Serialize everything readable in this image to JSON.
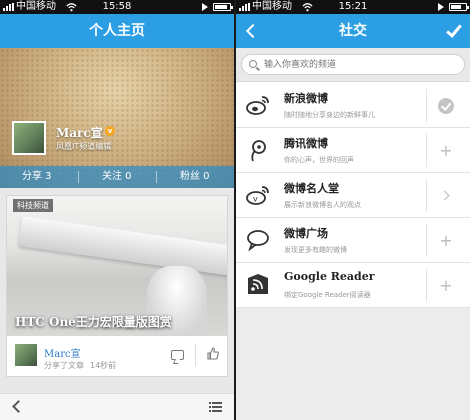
{
  "colors": {
    "nav_blue": "#2c9ee4",
    "stats_bar": "#2d8cc8",
    "link_blue": "#2c7bc4"
  },
  "left": {
    "status": {
      "carrier": "中国移动",
      "time": "15:58"
    },
    "nav": {
      "title": "个人主页"
    },
    "profile": {
      "name": "Marc宣",
      "verified_badge": "v",
      "bio": "凤凰IT频道编辑",
      "stats": {
        "shares": "分享 3",
        "following": "关注 0",
        "followers": "粉丝 0"
      }
    },
    "feed": {
      "tag": "科技频道",
      "title": "HTC One王力宏限量版图赏",
      "author": "Marc宣",
      "action": "分享了文章",
      "time": "14秒前",
      "icons": [
        "comment-icon",
        "like-icon"
      ]
    },
    "bottombar": {
      "icons": [
        "back-icon",
        "menu-icon"
      ]
    }
  },
  "right": {
    "status": {
      "carrier": "中国移动",
      "time": "15:21"
    },
    "nav": {
      "title": "社交",
      "icons": [
        "back-icon",
        "check-icon"
      ]
    },
    "search": {
      "placeholder": "输入你喜欢的频道"
    },
    "channels": [
      {
        "name": "新浪微博",
        "desc": "随时随地分享身边的新鲜事儿",
        "icon": "sina-weibo-icon",
        "action": "added-check-icon"
      },
      {
        "name": "腾讯微博",
        "desc": "你的心声，世界的回声",
        "icon": "tencent-weibo-icon",
        "action": "plus-icon"
      },
      {
        "name": "微博名人堂",
        "desc": "展示新浪微博名人的观点",
        "icon": "weibo-celebrity-icon",
        "action": "arrow-right-icon"
      },
      {
        "name": "微博广场",
        "desc": "发现更多有趣的微博",
        "icon": "weibo-square-icon",
        "action": "plus-icon"
      },
      {
        "name": "Google Reader",
        "desc": "绑定Google Reader阅读器",
        "icon": "google-reader-icon",
        "action": "plus-icon"
      }
    ]
  }
}
